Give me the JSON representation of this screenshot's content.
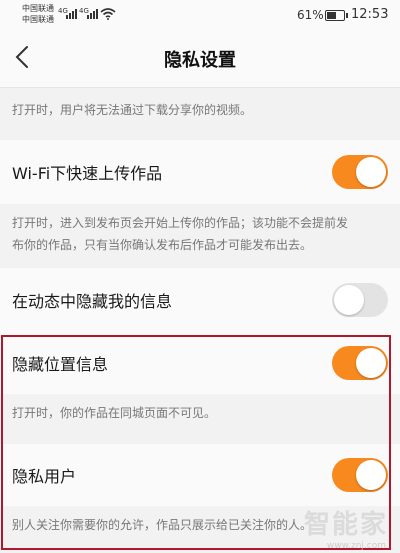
{
  "status_bar": {
    "carrier_1": "中国联通",
    "carrier_2": "中国联通",
    "signal_label_1": "4G",
    "signal_label_2": "4G",
    "battery_percent": "61%",
    "battery_level": 0.61,
    "time": "12:53"
  },
  "nav": {
    "back_icon": "chevron-left-icon",
    "title": "隐私设置"
  },
  "settings": {
    "top_desc": "打开时，用户将无法通过下载分享你的视频。",
    "wifi_upload": {
      "label": "Wi-Fi下快速上传作品",
      "enabled": true,
      "desc_1": "打开时，进入到发布页会开始上传你的作品；该功能不会提前发",
      "desc_2": "布你的作品，只有当你确认发布后作品才可能发布出去。"
    },
    "hide_activity": {
      "label": "在动态中隐藏我的信息",
      "enabled": false
    },
    "hide_location": {
      "label": "隐藏位置信息",
      "enabled": true,
      "desc": "打开时，你的作品在同城页面不可见。"
    },
    "private_user": {
      "label": "隐私用户",
      "enabled": true,
      "desc": "别人关注你需要你的允许，作品只展示给已关注你的人。"
    }
  },
  "colors": {
    "toggle_on": "#f7891e",
    "toggle_off": "#e3e3e3",
    "highlight_border": "#b2182b"
  },
  "watermark": {
    "text": "智能家",
    "sub": "www.znj.com"
  }
}
